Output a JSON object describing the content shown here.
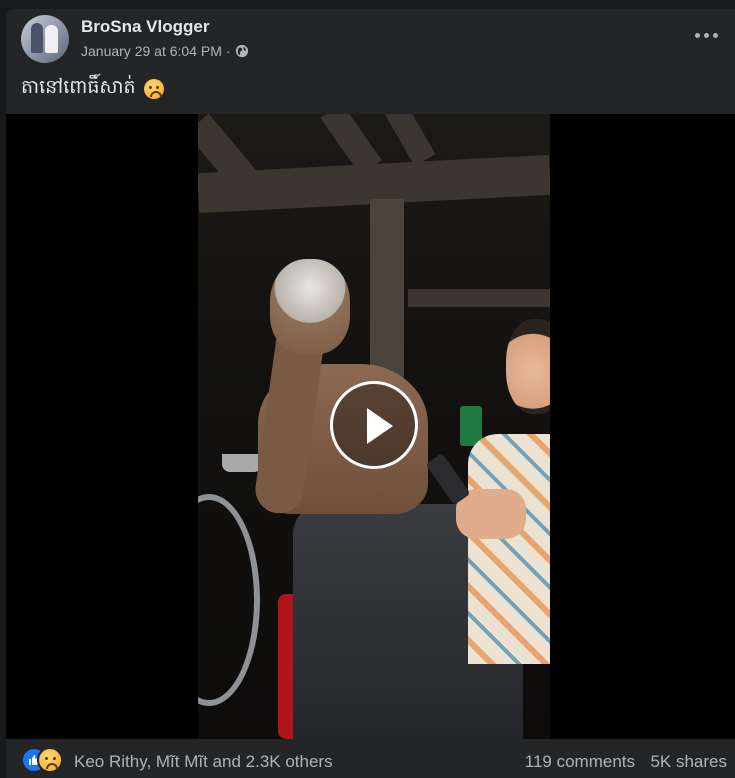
{
  "post": {
    "author_name": "BroSna Vlogger",
    "timestamp": "January 29 at 6:04 PM",
    "separator": "·",
    "privacy_icon": "globe-icon",
    "more_icon": "more-options-icon",
    "caption_text": "តានៅពោធិ៍សាត់",
    "caption_emoji": "sad-face-emoji"
  },
  "video": {
    "play_icon": "play-icon"
  },
  "engagement": {
    "reaction_icons": [
      "like-icon",
      "sad-reaction-icon"
    ],
    "reactions_summary": "Keo Rithy, Mĩt Mĩt and 2.3K others",
    "comments": "119 comments",
    "shares": "5K shares"
  },
  "colors": {
    "background": "#18191a",
    "card": "#242526",
    "primary_text": "#e4e6eb",
    "secondary_text": "#b0b3b8",
    "like_blue": "#1877f2"
  }
}
